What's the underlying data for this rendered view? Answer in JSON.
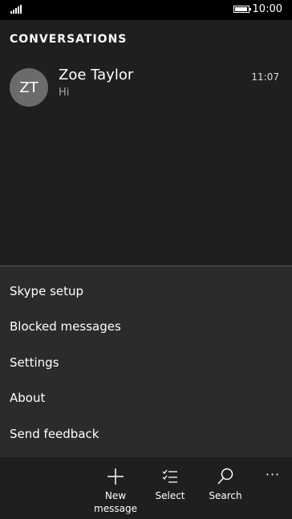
{
  "status_bar": {
    "time": "10:00",
    "signal_icon": "signal-strength-icon",
    "battery_icon": "battery-full-icon"
  },
  "page": {
    "title": "CONVERSATIONS"
  },
  "conversations": [
    {
      "initials": "ZT",
      "name": "Zoe Taylor",
      "preview": "Hi",
      "time": "11:07"
    }
  ],
  "menu": {
    "items": [
      {
        "label": "Skype setup"
      },
      {
        "label": "Blocked messages"
      },
      {
        "label": "Settings"
      },
      {
        "label": "About"
      },
      {
        "label": "Send feedback"
      }
    ]
  },
  "appbar": {
    "buttons": [
      {
        "label": "New message",
        "icon": "plus-icon"
      },
      {
        "label": "Select",
        "icon": "select-list-icon"
      },
      {
        "label": "Search",
        "icon": "search-icon"
      }
    ],
    "more_label": "···"
  },
  "colors": {
    "background": "#1f1f1f",
    "menu_background": "#2b2b2b",
    "avatar": "#6b6b6b",
    "secondary_text": "#a8a8a8"
  }
}
